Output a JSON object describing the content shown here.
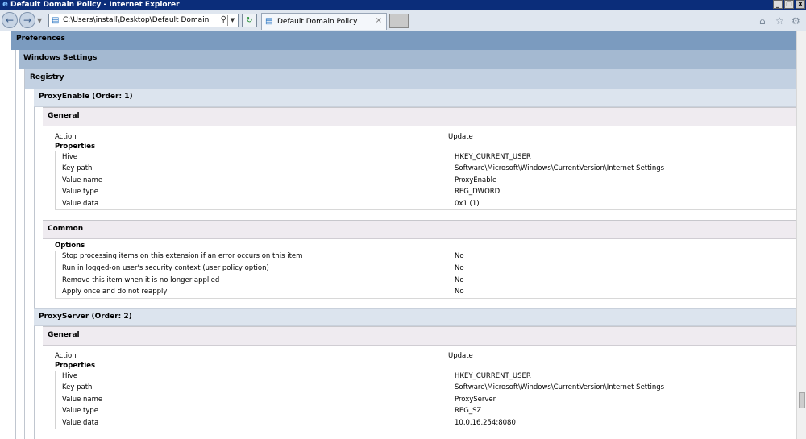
{
  "window": {
    "title": "Default Domain Policy - Internet Explorer",
    "controls": [
      "_",
      "❐",
      "X"
    ]
  },
  "browser": {
    "address": "C:\\Users\\install\\Desktop\\Default Domain Policy.h",
    "tab_title": "Default Domain Policy"
  },
  "report": {
    "preferences": "Preferences",
    "windows_settings": "Windows Settings",
    "registry": "Registry",
    "item1": {
      "title": "ProxyEnable (Order: 1)",
      "general": "General",
      "action_label": "Action",
      "action_value": "Update",
      "properties": "Properties",
      "rows": [
        {
          "label": "Hive",
          "value": "HKEY_CURRENT_USER"
        },
        {
          "label": "Key path",
          "value": "Software\\Microsoft\\Windows\\CurrentVersion\\Internet Settings"
        },
        {
          "label": "Value name",
          "value": "ProxyEnable"
        },
        {
          "label": "Value type",
          "value": "REG_DWORD"
        },
        {
          "label": "Value data",
          "value": "0x1 (1)"
        }
      ],
      "common": "Common",
      "options": "Options",
      "option_rows": [
        {
          "label": "Stop processing items on this extension if an error occurs on this item",
          "value": "No"
        },
        {
          "label": "Run in logged-on user's security context (user policy option)",
          "value": "No"
        },
        {
          "label": "Remove this item when it is no longer applied",
          "value": "No"
        },
        {
          "label": "Apply once and do not reapply",
          "value": "No"
        }
      ]
    },
    "item2": {
      "title": "ProxyServer (Order: 2)",
      "general": "General",
      "action_label": "Action",
      "action_value": "Update",
      "properties": "Properties",
      "rows": [
        {
          "label": "Hive",
          "value": "HKEY_CURRENT_USER"
        },
        {
          "label": "Key path",
          "value": "Software\\Microsoft\\Windows\\CurrentVersion\\Internet Settings"
        },
        {
          "label": "Value name",
          "value": "ProxyServer"
        },
        {
          "label": "Value type",
          "value": "REG_SZ"
        },
        {
          "label": "Value data",
          "value": "10.0.16.254:8080"
        }
      ]
    }
  }
}
